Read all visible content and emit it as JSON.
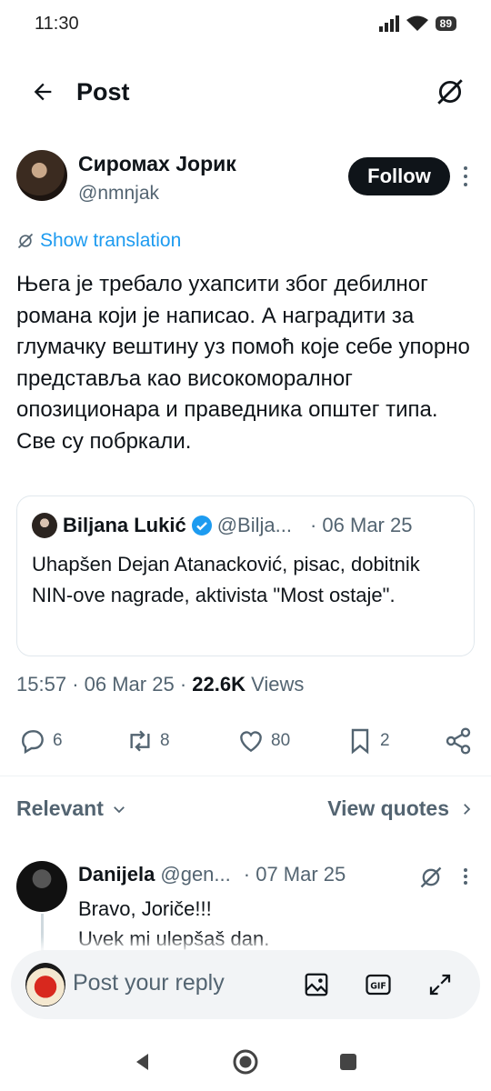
{
  "status_bar": {
    "time": "11:30",
    "battery": "89"
  },
  "header": {
    "title": "Post"
  },
  "author": {
    "name": "Сиромах Јорик",
    "handle": "@nmnjak",
    "follow_label": "Follow"
  },
  "show_translation": "Show translation",
  "post_text": "Њега је требало ухапсити због дебилног романа који је написао. А наградити за глумачку вештину уз помоћ које себе упорно представља као високоморалног опозиционара и праведника општег типа. Све су побркали.",
  "quote": {
    "name": "Biljana Lukić",
    "handle": "@Bilja...",
    "date": "· 06 Mar 25",
    "text": "Uhapšen Dejan Atanacković, pisac, dobitnik NIN-ove nagrade, aktivista \"Most ostaje\"."
  },
  "meta": {
    "time": "15:57",
    "sep1": "·",
    "date": "06 Mar 25",
    "sep2": "·",
    "views_count": "22.6K",
    "views_label": "Views"
  },
  "actions": {
    "replies": "6",
    "reposts": "8",
    "likes": "80",
    "bookmarks": "2"
  },
  "filter": {
    "relevant_label": "Relevant",
    "view_quotes_label": "View quotes"
  },
  "reply": {
    "name": "Danijela",
    "handle": "@gen...",
    "date": "· 07 Mar 25",
    "line1": "Bravo, Joriče!!!",
    "line2": "Uvek mi ulepšaš dan."
  },
  "reply_bar": {
    "placeholder": "Post your reply"
  },
  "colors": {
    "accent": "#1d9bf0",
    "text": "#0f1419",
    "secondary": "#536471"
  },
  "icons": [
    "back-arrow-icon",
    "translate-icon",
    "more-icon",
    "verified-icon",
    "reply-icon",
    "repost-icon",
    "like-icon",
    "bookmark-icon",
    "share-icon",
    "chevron-down-icon",
    "chevron-right-icon",
    "image-icon",
    "gif-icon",
    "expand-icon"
  ]
}
